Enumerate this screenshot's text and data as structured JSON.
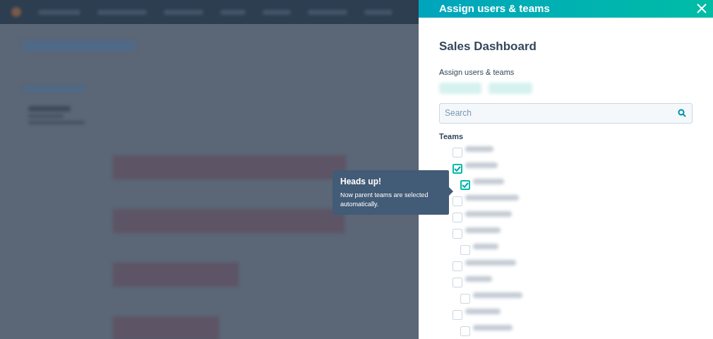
{
  "panel": {
    "title": "Assign users & teams",
    "heading": "Sales Dashboard",
    "assign_label": "Assign users & teams",
    "search": {
      "placeholder": "Search"
    },
    "teams_label": "Teams",
    "teams": [
      {
        "checked": false
      },
      {
        "checked": true,
        "children": [
          {
            "checked": true
          }
        ]
      },
      {
        "checked": false
      },
      {
        "checked": false
      },
      {
        "checked": false,
        "children": [
          {
            "checked": false
          }
        ]
      },
      {
        "checked": false
      },
      {
        "checked": false,
        "children": [
          {
            "checked": false
          }
        ]
      },
      {
        "checked": false,
        "children": [
          {
            "checked": false
          }
        ]
      }
    ]
  },
  "tooltip": {
    "title": "Heads up!",
    "text": "Now parent teams are selected automatically."
  }
}
